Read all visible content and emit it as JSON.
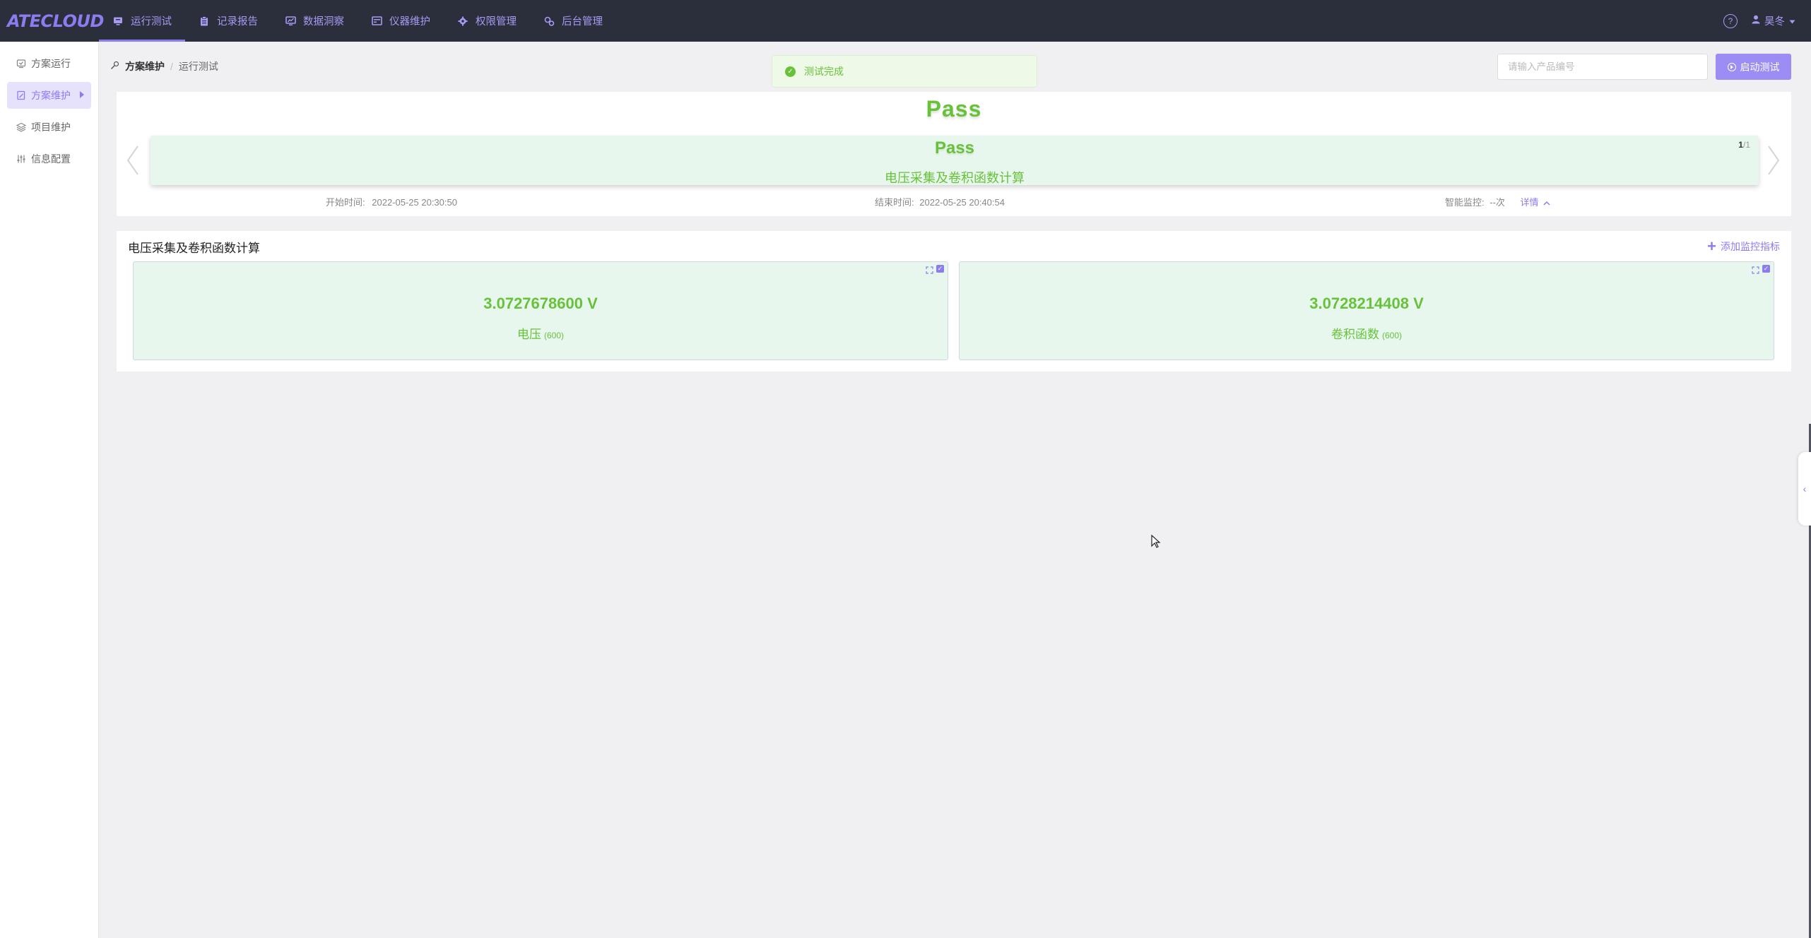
{
  "app": {
    "logo": "ATECLOUD"
  },
  "topnav": {
    "items": [
      {
        "label": "运行测试",
        "icon": "monitor-icon",
        "active": true
      },
      {
        "label": "记录报告",
        "icon": "clipboard-icon",
        "active": false
      },
      {
        "label": "数据洞察",
        "icon": "chart-screen-icon",
        "active": false
      },
      {
        "label": "仪器维护",
        "icon": "instrument-icon",
        "active": false
      },
      {
        "label": "权限管理",
        "icon": "gear-group-icon",
        "active": false
      },
      {
        "label": "后台管理",
        "icon": "admin-icon",
        "active": false
      }
    ],
    "help": "?",
    "user": "昊冬"
  },
  "sidebar": {
    "items": [
      {
        "label": "方案运行",
        "icon": "run-icon",
        "active": false
      },
      {
        "label": "方案维护",
        "icon": "edit-doc-icon",
        "active": true
      },
      {
        "label": "项目维护",
        "icon": "layers-icon",
        "active": false
      },
      {
        "label": "信息配置",
        "icon": "sliders-icon",
        "active": false
      }
    ]
  },
  "breadcrumb": {
    "parent": "方案维护",
    "sep": "/",
    "current": "运行测试"
  },
  "toast": {
    "text": "测试完成"
  },
  "search": {
    "placeholder": "请输入产品编号"
  },
  "start_button": {
    "label": "启动测试"
  },
  "result": {
    "overall": "Pass",
    "card": {
      "status": "Pass",
      "name": "电压采集及卷积函数计算",
      "page_current": "1",
      "page_total": "/1"
    },
    "start_time_label": "开始时间:",
    "start_time": "2022-05-25 20:30:50",
    "end_time_label": "结束时间:",
    "end_time": "2022-05-25 20:40:54",
    "monitor_label": "智能监控:",
    "monitor_value": "--次",
    "detail_link": "详情"
  },
  "monitor": {
    "title": "电压采集及卷积函数计算",
    "add_label": "添加监控指标",
    "cards": [
      {
        "value": "3.0727678600 V",
        "name": "电压",
        "count": "(600)"
      },
      {
        "value": "3.0728214408 V",
        "name": "卷积函数",
        "count": "(600)"
      }
    ]
  },
  "colors": {
    "accent": "#8c7cf0",
    "topbar": "#2b2e3b",
    "pass": "#67c23a",
    "card_bg": "#e8f7ee"
  }
}
